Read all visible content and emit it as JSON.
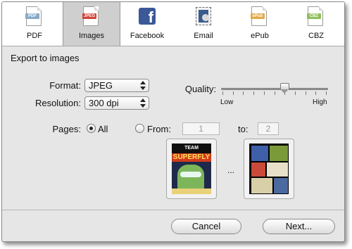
{
  "tabs": [
    {
      "label": "PDF",
      "icon": "pdf-document-icon",
      "badge": "PDF",
      "badge_color": "#8aa8c8"
    },
    {
      "label": "Images",
      "icon": "jpeg-document-icon",
      "badge": "JPEG",
      "badge_color": "#d0453a",
      "selected": true
    },
    {
      "label": "Facebook",
      "icon": "facebook-icon"
    },
    {
      "label": "Email",
      "icon": "stamp-icon"
    },
    {
      "label": "ePub",
      "icon": "epub-document-icon",
      "badge": "ePub",
      "badge_color": "#e2a94a"
    },
    {
      "label": "CBZ",
      "icon": "cbz-document-icon",
      "badge": "CBZ",
      "badge_color": "#8fbf5a"
    }
  ],
  "section_title": "Export to images",
  "format": {
    "label": "Format:",
    "value": "JPEG"
  },
  "resolution": {
    "label": "Resolution:",
    "value": "300 dpi"
  },
  "quality": {
    "label": "Quality:",
    "low": "Low",
    "high": "High",
    "level": 0.6
  },
  "pages": {
    "label": "Pages:",
    "all_label": "All",
    "from_label": "From:",
    "from_value": "1",
    "to_label": "to:",
    "to_value": "2",
    "ellipsis": "..."
  },
  "cover_texts": {
    "top": "TEAM",
    "title": "SUPERFLY"
  },
  "buttons": {
    "cancel": "Cancel",
    "next": "Next..."
  }
}
